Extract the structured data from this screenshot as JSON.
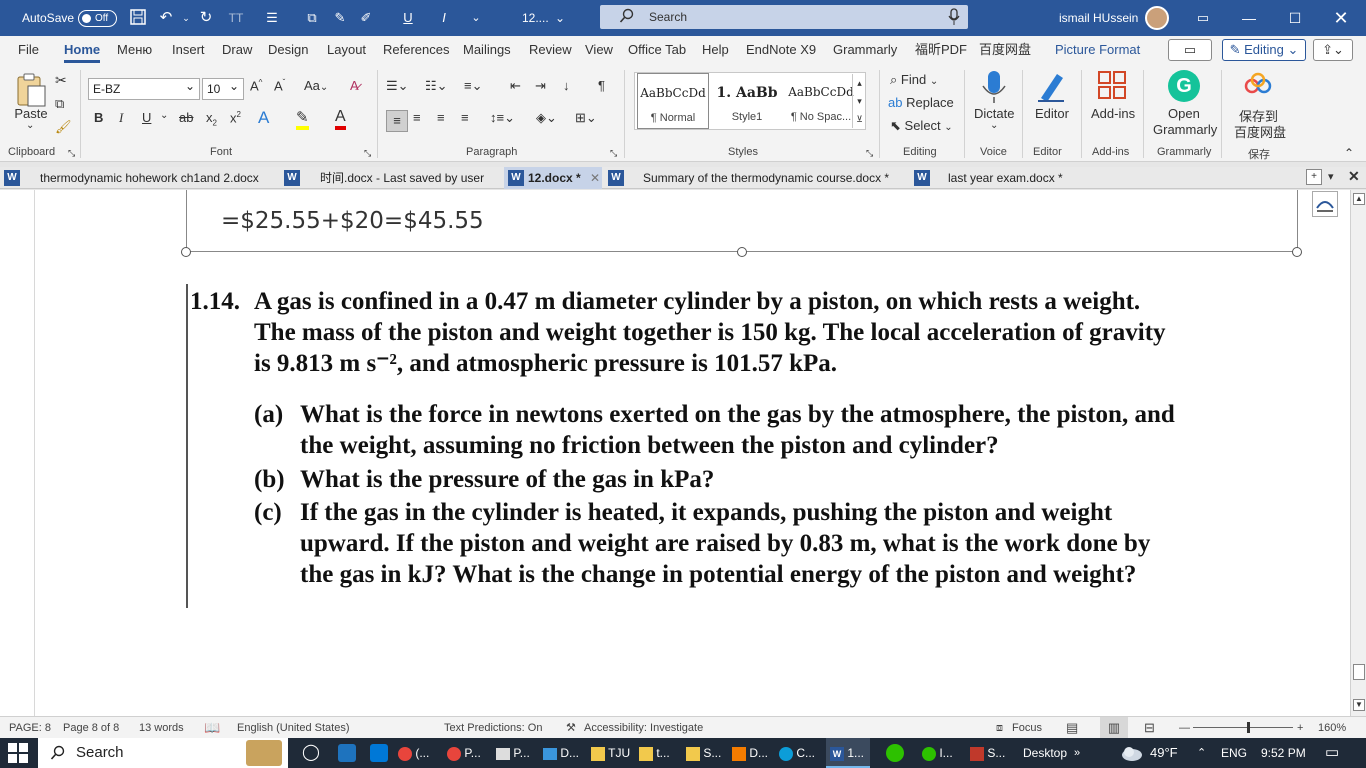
{
  "titlebar": {
    "autosave_label": "AutoSave",
    "autosave_state": "Off",
    "doc_short": "12....",
    "search_placeholder": "Search",
    "user_name": "ismail HUssein",
    "bg_color": "#2b579a"
  },
  "ribbon_tabs": [
    "File",
    "Home",
    "Меню",
    "Insert",
    "Draw",
    "Design",
    "Layout",
    "References",
    "Mailings",
    "Review",
    "View",
    "Office Tab",
    "Help",
    "EndNote X9",
    "Grammarly",
    "福昕PDF",
    "百度网盘",
    "Picture Format"
  ],
  "ribbon_right": {
    "editing_label": "Editing"
  },
  "clipboard": {
    "paste": "Paste",
    "group": "Clipboard"
  },
  "font": {
    "name": "E-BZ",
    "size": "10",
    "group": "Font",
    "case_btn": "Aa"
  },
  "paragraph": {
    "group": "Paragraph"
  },
  "styles": {
    "group": "Styles",
    "items": [
      {
        "preview": "AaBbCcDd",
        "name": "¶ Normal"
      },
      {
        "preview": "1. AaBb",
        "name": "Style1"
      },
      {
        "preview": "AaBbCcDd",
        "name": "¶ No Spac..."
      }
    ]
  },
  "editing": {
    "find": "Find",
    "replace": "Replace",
    "select": "Select",
    "group": "Editing"
  },
  "voice": {
    "dictate": "Dictate",
    "group": "Voice"
  },
  "editor": {
    "label": "Editor",
    "group": "Editor"
  },
  "addins": {
    "label": "Add-ins",
    "group": "Add-ins"
  },
  "grammarly": {
    "label1": "Open",
    "label2": "Grammarly",
    "group": "Grammarly"
  },
  "baidu": {
    "label1": "保存到",
    "label2": "百度网盘",
    "group": "保存"
  },
  "doc_tabs": [
    {
      "title": "thermodynamic hohework ch1and 2.docx"
    },
    {
      "title": "时间.docx  -  Last saved by user"
    },
    {
      "title": "12.docx *"
    },
    {
      "title": "Summary of the thermodynamic course.docx *"
    },
    {
      "title": "last year exam.docx *"
    }
  ],
  "document": {
    "equation": "=$25.55+$20=$45.55",
    "problem_number": "1.14.",
    "intro": [
      "A gas is confined in a 0.47 m diameter cylinder by a piston, on which rests a weight.",
      "The mass of the piston and weight together is 150 kg.  The local acceleration of gravity",
      "is 9.813 m s⁻², and atmospheric pressure is 101.57 kPa."
    ],
    "parts": [
      {
        "label": "(a)",
        "lines": [
          "What is the force in newtons exerted on the gas by the atmosphere, the piston, and",
          "the weight, assuming no friction between the piston and cylinder?"
        ]
      },
      {
        "label": "(b)",
        "lines": [
          "What is the pressure of the gas in kPa?"
        ]
      },
      {
        "label": "(c)",
        "lines": [
          "If the gas in the cylinder is heated, it expands, pushing the piston and weight",
          "upward.  If the piston and weight are raised by 0.83 m, what is the work done by",
          "the gas in kJ? What is the change in potential energy of the piston and weight?"
        ]
      }
    ]
  },
  "statusbar": {
    "page": "PAGE: 8",
    "page_of": "Page 8 of 8",
    "words": "13 words",
    "language": "English (United States)",
    "predictions": "Text Predictions: On",
    "accessibility": "Accessibility: Investigate",
    "focus": "Focus",
    "zoom": "160%"
  },
  "taskbar": {
    "search": "Search",
    "apps": [
      "(...",
      "P...",
      "P...",
      "D...",
      "TJU",
      "t...",
      "S...",
      "D...",
      "C...",
      "1...",
      "I...",
      "S..."
    ],
    "desktop": "Desktop",
    "temperature": "49°F",
    "lang": "ENG",
    "time": "9:52 PM"
  }
}
